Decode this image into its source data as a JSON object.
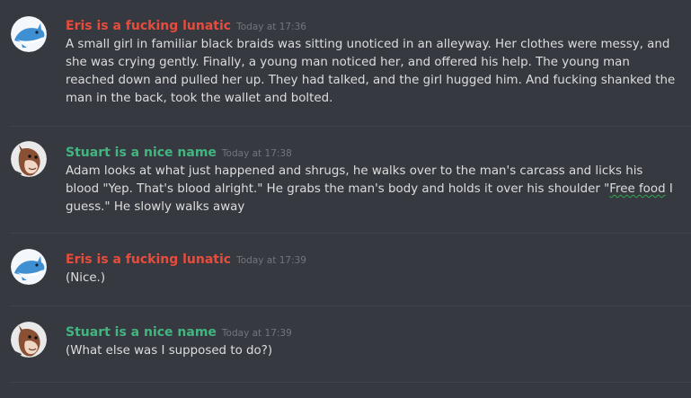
{
  "colors": {
    "background": "#36393f",
    "text": "#dcddde",
    "timestamp": "#72767d",
    "user_red": "#e74c3c",
    "user_green": "#43b581",
    "spellcheck_underline": "#2fa84f"
  },
  "messages": [
    {
      "username": "Eris is a fucking lunatic",
      "timestamp": "Today at 17:36",
      "avatar": "blue-shark-avatar",
      "user_color": "#e74c3c",
      "text": "A small girl in familiar black braids was sitting unoticed in an alleyway. Her clothes were messy, and she was crying gently. Finally, a young man noticed her, and offered his help. The young man reached down and pulled her up. They had talked, and the girl hugged him. And fucking shanked the man in the back, took the wallet and bolted."
    },
    {
      "username": "Stuart is a nice name",
      "timestamp": "Today at 17:38",
      "avatar": "horse-avatar",
      "user_color": "#43b581",
      "text_before": "Adam looks at what just happened and shrugs, he walks over to the man's carcass and licks his blood \"Yep. That's blood alright.\" He grabs the man's body and holds it over his shoulder \"",
      "text_underlined": "Free food",
      "text_after": " I guess.\" He slowly walks away"
    },
    {
      "username": "Eris is a fucking lunatic",
      "timestamp": "Today at 17:39",
      "avatar": "blue-shark-avatar",
      "user_color": "#e74c3c",
      "text": "(Nice.)"
    },
    {
      "username": "Stuart is a nice name",
      "timestamp": "Today at 17:39",
      "avatar": "horse-avatar",
      "user_color": "#43b581",
      "text": "(What else was I supposed to do?)"
    }
  ]
}
